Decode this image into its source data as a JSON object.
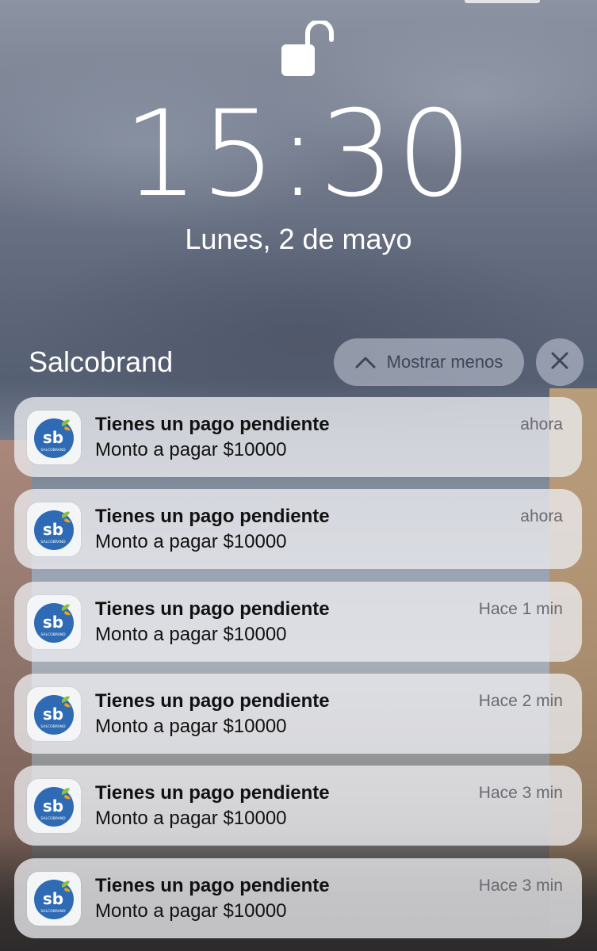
{
  "lock_screen": {
    "time": "15:30",
    "date": "Lunes, 2 de mayo"
  },
  "notification_group": {
    "app_name": "Salcobrand",
    "show_less_label": "Mostrar menos",
    "app_icon_text": "sb",
    "app_icon_subtext": "SALCOBRAND",
    "colors": {
      "icon_blue": "#2f6bb5",
      "icon_leaf": "#8cbf3f",
      "icon_leaf_orange": "#f0a020"
    }
  },
  "notifications": [
    {
      "title": "Tienes un pago pendiente",
      "body": "Monto a pagar $10000",
      "time": "ahora"
    },
    {
      "title": "Tienes un pago pendiente",
      "body": "Monto a pagar $10000",
      "time": "ahora"
    },
    {
      "title": "Tienes un pago pendiente",
      "body": "Monto a pagar $10000",
      "time": "Hace 1 min"
    },
    {
      "title": "Tienes un pago pendiente",
      "body": "Monto a pagar $10000",
      "time": "Hace 2 min"
    },
    {
      "title": "Tienes un pago pendiente",
      "body": "Monto a pagar $10000",
      "time": "Hace 3 min"
    },
    {
      "title": "Tienes un pago pendiente",
      "body": "Monto a pagar $10000",
      "time": "Hace 3 min"
    }
  ]
}
